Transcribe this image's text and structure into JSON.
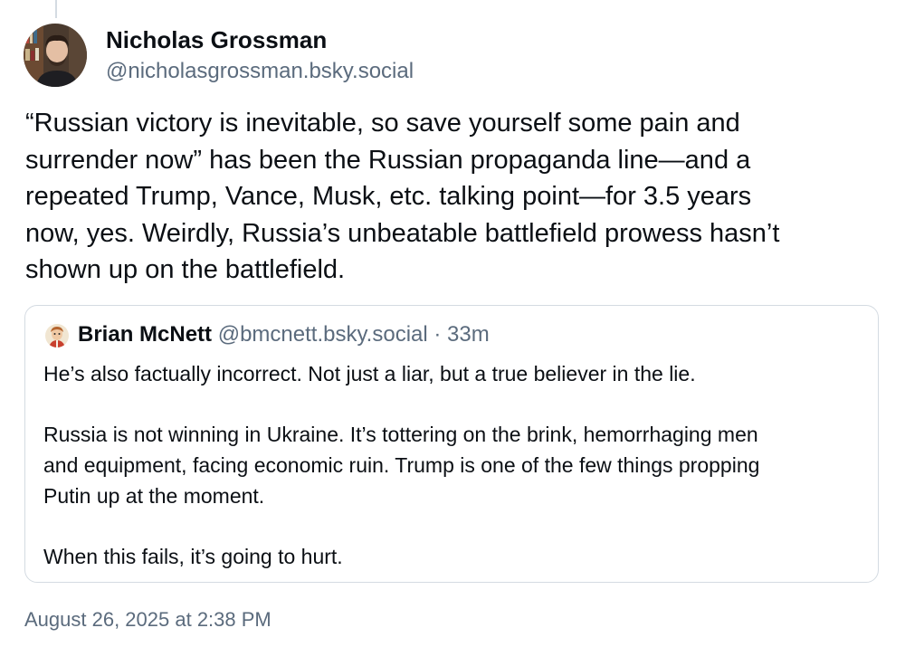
{
  "post": {
    "author": {
      "name": "Nicholas Grossman",
      "handle": "@nicholasgrossman.bsky.social"
    },
    "text_lines": [
      "“Russian victory is inevitable, so save yourself some pain and",
      "surrender now” has been the Russian propaganda line—and a",
      "repeated Trump, Vance, Musk, etc. talking point—for 3.5 years",
      "now, yes. Weirdly, Russia’s unbeatable battlefield prowess hasn’t",
      "shown up on the battlefield."
    ],
    "timestamp": "August 26, 2025 at 2:38 PM"
  },
  "quote": {
    "author_name": "Brian McNett",
    "author_handle": "@bmcnett.bsky.social",
    "separator": "·",
    "time_ago": "33m",
    "paragraphs": [
      [
        "He’s also factually incorrect. Not just a liar, but a true believer in the lie."
      ],
      [
        "Russia is not winning in Ukraine. It’s tottering on the brink, hemorrhaging men",
        "and equipment, facing economic ruin. Trump is one of the few things propping",
        "Putin up at the moment."
      ],
      [
        "When this fails, it’s going to hurt."
      ]
    ]
  },
  "colors": {
    "text": "#0b0f14",
    "muted": "#5b6b7d",
    "border": "#d4dbe2",
    "background": "#ffffff"
  },
  "icons": {
    "author_avatar": "avatar-photo",
    "quote_avatar": "avatar-illustration"
  }
}
